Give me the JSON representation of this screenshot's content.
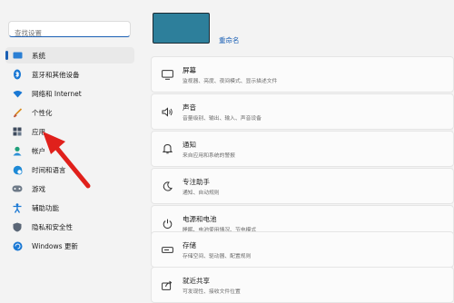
{
  "search": {
    "placeholder": "查找设置"
  },
  "sidebar": {
    "items": [
      {
        "label": "系统",
        "icon": "monitor-icon",
        "active": true
      },
      {
        "label": "蓝牙和其他设备",
        "icon": "bluetooth-icon"
      },
      {
        "label": "网络和 Internet",
        "icon": "wifi-icon"
      },
      {
        "label": "个性化",
        "icon": "brush-icon"
      },
      {
        "label": "应用",
        "icon": "apps-icon"
      },
      {
        "label": "帐户",
        "icon": "account-icon"
      },
      {
        "label": "时间和语言",
        "icon": "globe-clock-icon"
      },
      {
        "label": "游戏",
        "icon": "gamepad-icon"
      },
      {
        "label": "辅助功能",
        "icon": "accessibility-icon"
      },
      {
        "label": "隐私和安全性",
        "icon": "shield-icon"
      },
      {
        "label": "Windows 更新",
        "icon": "windows-update-icon"
      }
    ]
  },
  "device": {
    "rename_label": "重命名"
  },
  "cards": [
    {
      "title": "屏幕",
      "desc": "监视器、亮度、夜间模式、显示描述文件",
      "icon": "display-icon"
    },
    {
      "title": "声音",
      "desc": "音量级别、输出、输入、声音设备",
      "icon": "speaker-icon"
    },
    {
      "title": "通知",
      "desc": "来自应用和系统的警报",
      "icon": "bell-icon"
    },
    {
      "title": "专注助手",
      "desc": "通知、自动规则",
      "icon": "moon-icon"
    },
    {
      "title": "电源和电池",
      "desc": "睡眠、电池使用情况、节电模式",
      "icon": "power-icon"
    },
    {
      "title": "存储",
      "desc": "存储空间、驱动器、配置规则",
      "icon": "storage-icon"
    },
    {
      "title": "就近共享",
      "desc": "可发现性、接收文件位置",
      "icon": "share-icon"
    }
  ],
  "colors": {
    "accent": "#1a5fb4",
    "arrow": "#e0201b",
    "tile": "#2d7f9b"
  }
}
